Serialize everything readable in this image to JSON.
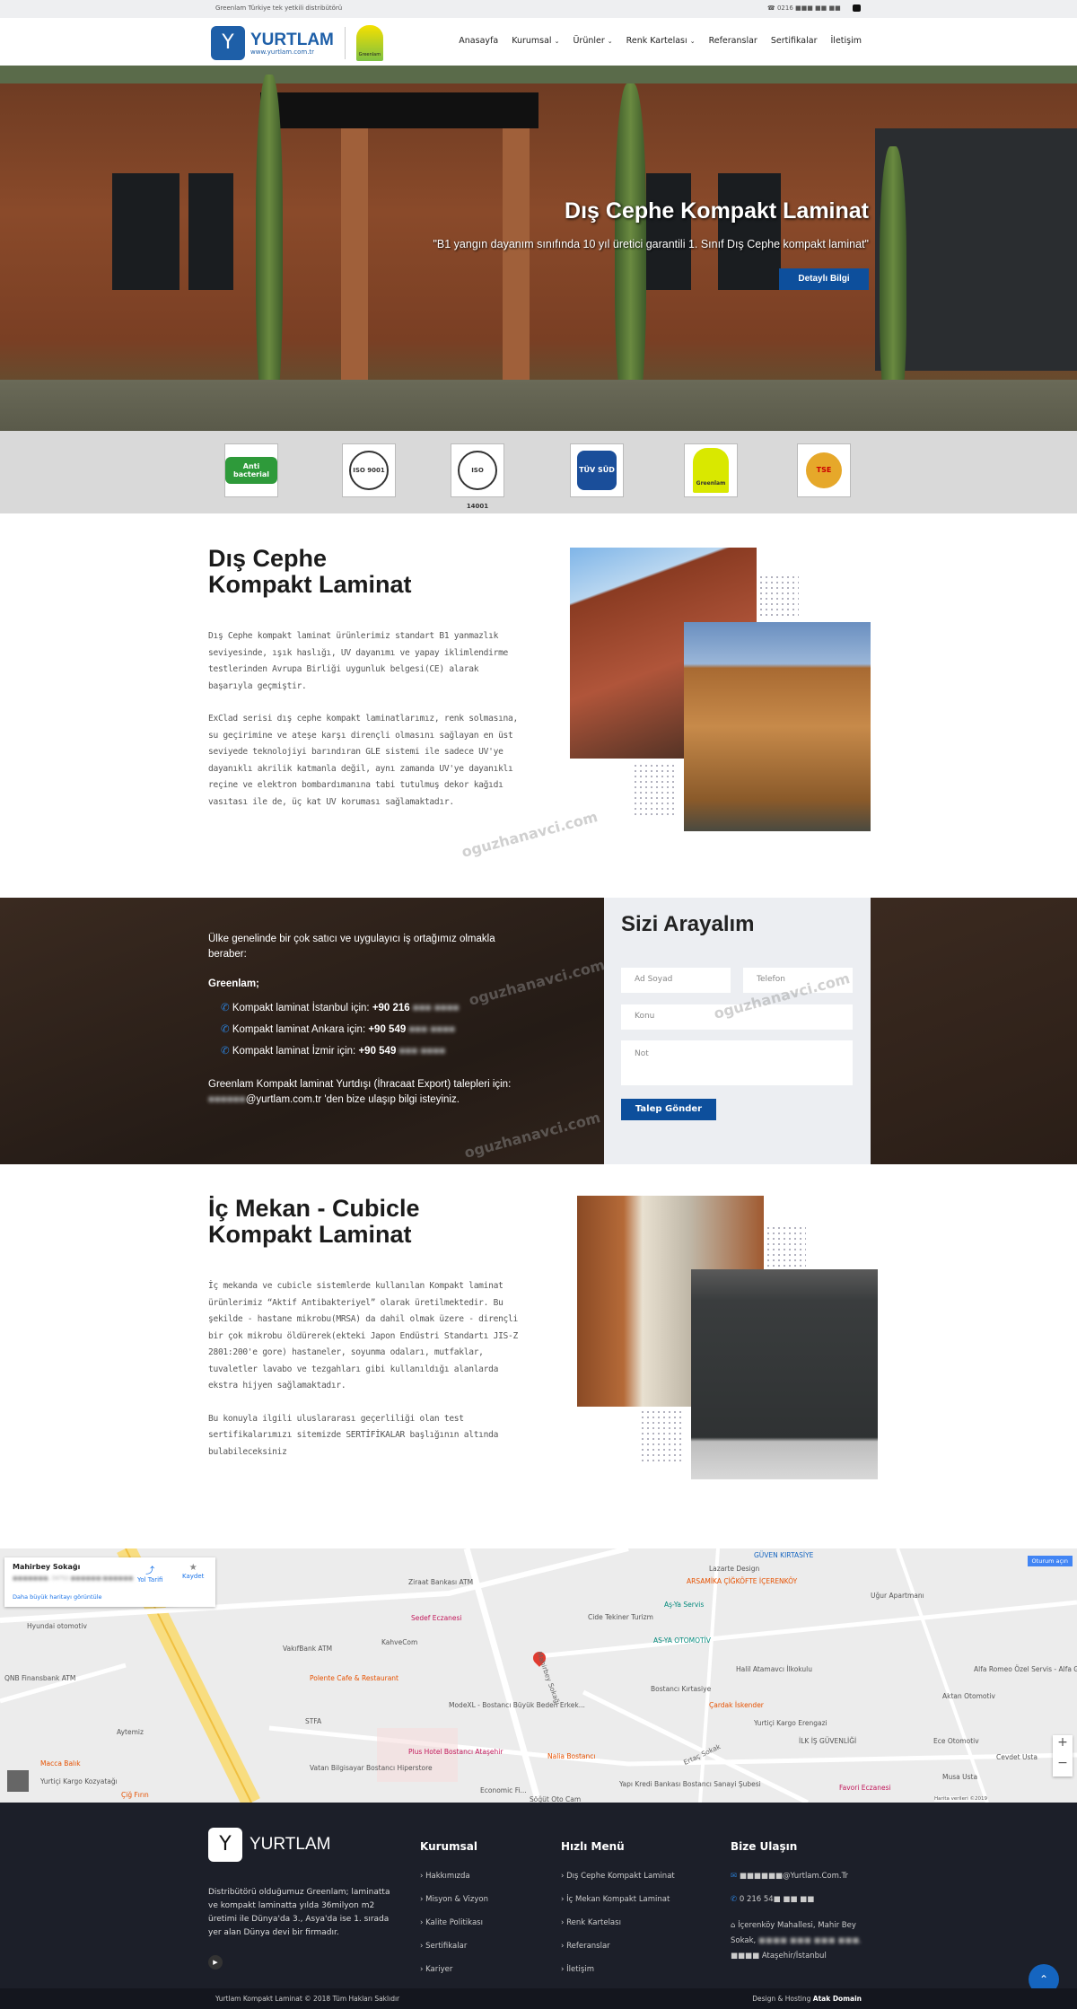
{
  "topbar": {
    "tagline": "Greenlam Türkiye tek yetkili distribütörü",
    "phone": "0216 ■■■ ■■ ■■",
    "youtube_icon": "youtube-icon"
  },
  "header": {
    "logo_text": "YURTLAM",
    "logo_url": "www.yurtlam.com.tr",
    "partner_logo": "Greenlam Laminates",
    "nav": [
      {
        "label": "Anasayfa"
      },
      {
        "label": "Kurumsal",
        "dropdown": true
      },
      {
        "label": "Ürünler",
        "dropdown": true
      },
      {
        "label": "Renk Kartelası",
        "dropdown": true
      },
      {
        "label": "Referanslar"
      },
      {
        "label": "Sertifikalar"
      },
      {
        "label": "İletişim"
      }
    ]
  },
  "hero": {
    "title": "Dış Cephe Kompakt Laminat",
    "subtitle": "\"B1 yangın dayanım sınıfında 10 yıl üretici garantili 1. Sınıf Dış Cephe kompakt laminat\"",
    "button": "Detaylı Bilgi",
    "accent": "#0d4f9c"
  },
  "certificates": [
    {
      "label": "Anti bacterial"
    },
    {
      "label": "ISO 9001"
    },
    {
      "label": "ISO 14001"
    },
    {
      "label": "TÜV SÜD"
    },
    {
      "label": "Greenlam"
    },
    {
      "label": "TSE"
    }
  ],
  "section1": {
    "title_line1": "Dış Cephe",
    "title_line2": "Kompakt Laminat",
    "para1": "Dış Cephe kompakt laminat ürünlerimiz standart B1 yanmazlık seviyesinde, ışık haslığı, UV dayanımı ve yapay iklimlendirme testlerinden Avrupa Birliği uygunluk belgesi(CE) alarak başarıyla geçmiştir.",
    "para2": "ExClad serisi dış cephe kompakt laminatlarımız, renk solmasına, su geçirimine ve ateşe karşı dirençli olmasını sağlayan en üst seviyede teknolojiyi barındıran GLE sistemi ile sadece UV'ye dayanıklı akrilik katmanla değil, aynı zamanda UV'ye dayanıklı reçine ve elektron bombardımanına tabi tutulmuş dekor kağıdı vasıtası ile de, üç kat UV koruması sağlamaktadır."
  },
  "watermark": "oguzhanavci.com",
  "contact_band": {
    "intro": "Ülke genelinde bir çok satıcı ve uygulayıcı iş ortağımız olmakla beraber:",
    "brand": "Greenlam;",
    "lines": [
      {
        "label": "Kompakt laminat İstanbul için: ",
        "number": "+90 216",
        "blur": "■■■ ■■■■"
      },
      {
        "label": "Kompakt laminat Ankara için: ",
        "number": "+90 549",
        "blur": "■■■ ■■■■"
      },
      {
        "label": "Kompakt laminat İzmir için: ",
        "number": "+90 549",
        "blur": "■■■ ■■■■"
      }
    ],
    "export_text_1": "Greenlam Kompakt laminat Yurtdışı (İhracaat Export) talepleri için: ",
    "export_blur": "■■■■■■",
    "export_text_2": "@yurtlam.com.tr 'den bize ulaşıp bilgi isteyiniz."
  },
  "form": {
    "title": "Sizi Arayalım",
    "name_placeholder": "Ad Soyad",
    "phone_placeholder": "Telefon",
    "subject_placeholder": "Konu",
    "note_placeholder": "Not",
    "submit": "Talep Gönder"
  },
  "section2": {
    "title_line1": "İç Mekan - Cubicle",
    "title_line2": "Kompakt Laminat",
    "para1": "İç mekanda ve cubicle sistemlerde kullanılan Kompakt laminat ürünlerimiz “Aktif Antibakteriyel” olarak üretilmektedir. Bu şekilde - hastane mikrobu(MRSA) da dahil olmak üzere - dirençli bir çok mikrobu öldürerek(ekteki Japon Endüstri Standartı JIS-Z 2801:200'e gore) hastaneler, soyunma odaları, mutfaklar, tuvaletler lavabo ve tezgahları gibi kullanıldığı alanlarda ekstra hijyen sağlamaktadır.",
    "para2": "Bu konuyla ilgili uluslararası geçerliliği olan test sertifikalarımızı sitemizde SERTİFİKALAR başlığının altında bulabileceksiniz"
  },
  "map": {
    "place": "Mahirbey Sokağı",
    "address_blur": "■■■■■■■, 34752 ■■■■■■/■■■■■■",
    "directions": "Yol Tarifi",
    "save": "Kaydet",
    "larger_map": "Daha büyük haritayı görüntüle",
    "signin": "Oturum açın",
    "zoom_in": "+",
    "zoom_out": "−",
    "labels": [
      "Ziraat Bankası ATM",
      "Sedef Eczanesi",
      "KahveCom",
      "VakıfBank ATM",
      "Hyundai otomotiv",
      "QNB Finansbank ATM",
      "Polente Cafe & Restaurant",
      "STFA",
      "ModeXL - Bostancı Büyük Beden Erkek...",
      "Cide Tekiner Turizm",
      "AS-YA OTOMOTİV",
      "Halil Atamavcı İlkokulu",
      "Bostancı Kırtasiye",
      "Çardak İskender",
      "Yurtiçi Kargo Erengazi",
      "İLK İŞ GÜVENLİĞİ",
      "Alfa Romeo Özel Servis - Alfa Garaj",
      "Aktan Otomotiv",
      "Ece Otomotiv",
      "Cevdet Usta",
      "Musa Usta",
      "Plus Hotel Bostancı Ataşehir",
      "Vatan Bilgisayar Bostancı Hiperstore",
      "Nalia Bostancı",
      "Yapı Kredi Bankası Bostancı Sanayi Şubesi",
      "Macca Balık",
      "Yurtiçi Kargo Kozyatağı",
      "Çiğ Fırın",
      "GÜVEN KIRTASİYE",
      "Lazarte Design",
      "ARSAMİKA ÇİĞKÖFTE İÇERENKÖY",
      "Aş-Ya Servis",
      "Uğur Apartmanı",
      "Favori Eczanesi",
      "Economic Fi...",
      "Söğüt Oto Cam",
      "Mahirbey Sokağı",
      "Ertaç Sokak",
      "Aytemiz"
    ],
    "footer_note": "Harita verileri ©2019"
  },
  "footer": {
    "about": "Distribütörü olduğumuz Greenlam; laminatta ve kompakt laminatta yılda 36milyon m2 üretimi ile Dünya'da 3., Asya'da ise 1. sırada yer alan Dünya devi bir firmadır.",
    "col1_title": "Kurumsal",
    "col1": [
      "Hakkımızda",
      "Misyon & Vizyon",
      "Kalite Politikası",
      "Sertifikalar",
      "Kariyer"
    ],
    "col2_title": "Hızlı Menü",
    "col2": [
      "Dış Cephe Kompakt Laminat",
      "İç Mekan Kompakt Laminat",
      "Renk Kartelası",
      "Referanslar",
      "İletişim"
    ],
    "col3_title": "Bize Ulaşın",
    "email": "■■■■■■@Yurtlam.Com.Tr",
    "phone": "0 216 54■ ■■ ■■",
    "address_1": "İçerenköy Mahallesi, Mahir Bey Sokak,",
    "address_blur": "■■■■ ■■■ ■■■ ■■■,",
    "address_2": "■■■■ Ataşehir/İstanbul"
  },
  "bottombar": {
    "copyright": "Yurtlam Kompakt Laminat © 2018 Tüm Hakları Saklıdır",
    "credit_prefix": "Design & Hosting ",
    "credit_name": "Atak Domain"
  }
}
